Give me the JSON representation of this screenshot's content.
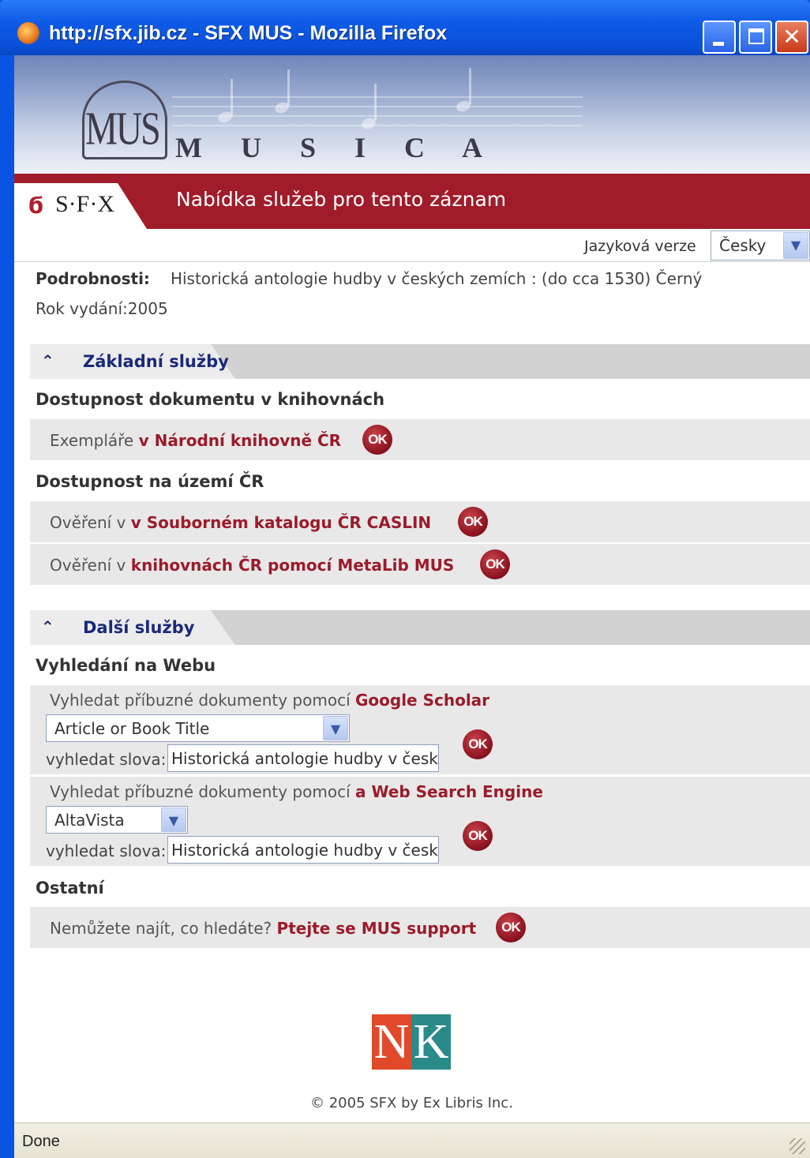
{
  "window": {
    "title": "http://sfx.jib.cz - SFX MUS - Mozilla Firefox"
  },
  "banner": {
    "logo_text": "MUS",
    "name": "M U S I C A"
  },
  "header": {
    "sfx_logo": "S·F·X",
    "title": "Nabídka služeb pro tento záznam"
  },
  "language": {
    "label": "Jazyková verze",
    "selected": "Česky"
  },
  "details": {
    "label": "Podrobnosti:",
    "value": "Historická antologie hudby v českých zemích : (do cca 1530) Černý",
    "year": "Rok vydání:2005"
  },
  "sections": {
    "basic": {
      "title": "Základní služby",
      "groups": {
        "libraries": {
          "title": "Dostupnost dokumentu v knihovnách",
          "items": [
            {
              "prefix": "Exempláře ",
              "link": "v Národní knihovně ČR",
              "ok": "OK"
            }
          ]
        },
        "territory": {
          "title": "Dostupnost na území ČR",
          "items": [
            {
              "prefix": "Ověření v ",
              "link": "v Souborném katalogu ČR CASLIN",
              "ok": "OK"
            },
            {
              "prefix": "Ověření v ",
              "link": "knihovnách ČR pomocí MetaLib MUS",
              "ok": "OK"
            }
          ]
        }
      }
    },
    "more": {
      "title": "Další služby",
      "groups": {
        "web": {
          "title": "Vyhledání na Webu",
          "items": [
            {
              "prefix": "Vyhledat příbuzné dokumenty pomocí ",
              "link": "Google Scholar",
              "select": "Article or Book Title",
              "field_label": "vyhledat slova:",
              "field_value": "Historická antologie hudby v českých",
              "ok": "OK"
            },
            {
              "prefix": "Vyhledat příbuzné dokumenty pomocí ",
              "link": "a Web Search Engine",
              "select": "AltaVista",
              "field_label": "vyhledat slova:",
              "field_value": "Historická antologie hudby v českých",
              "ok": "OK"
            }
          ]
        },
        "other": {
          "title": "Ostatní",
          "items": [
            {
              "prefix": "Nemůžete najít, co hledáte? ",
              "link": "Ptejte se MUS support",
              "ok": "OK"
            }
          ]
        }
      }
    }
  },
  "footer": {
    "logo_n": "N",
    "logo_k": "K",
    "copyright": "© 2005 SFX by Ex Libris Inc."
  },
  "status": {
    "text": "Done"
  },
  "colors": {
    "accent_red": "#9b1b2a",
    "header_red": "#a01c2a",
    "section_blue": "#1a2a7a"
  }
}
